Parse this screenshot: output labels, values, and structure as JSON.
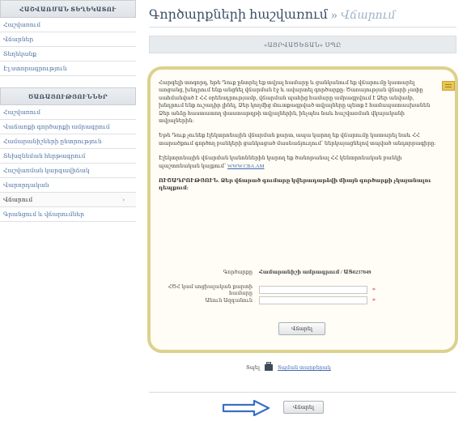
{
  "sidebar": {
    "section1_title": "ՀԱՇՎԱՌՄԱՆ ՏԵՂԵԿԱՏՈՒ",
    "section1_items": [
      "Հաշվառում",
      "Վճարներ",
      "Տեղեկանք",
      "Էլ.ստորագրություն"
    ],
    "section2_title": "ԾԱՌԱՅՈՒԹՅՈՒՆՆԵՐ",
    "section2_items": [
      "Հաշվառում",
      "Վաճառքի գործարքի ամրագրում",
      "Համարանիշների ընտրություն",
      "Տեխզննման հերթագրում",
      "Հաշվառման կարգավիճակ",
      "Վարորդական",
      "Վճարում",
      "Գրանցում և վճարումներ"
    ],
    "active_item": "Վճարում",
    "active_chev": "›"
  },
  "header": {
    "title": "Գործարքների հաշվառում",
    "separator": "»",
    "subtitle": "Վճարում"
  },
  "banner": "«ԱՅՐՎԱԾԵՏԱՆ» ՍՊԸ",
  "panel": {
    "p1": "Հարգելի տոգորդ, եթե Դուք ընտրել եք տվյալ համարը և ցանկանում եք վճարումը կատարել առցանց, խնդրում ենք անցնել վճարման էջ և ավարտել գործարքը: Ծառայության վճարի չափը սահմանված է ՀՀ օրենսդրությամբ, վճարման պահից համարը ամրագրվում է Ձեր անվամբ, խնդրում ենք ուշադիր լինել, Ձեր կողմից մուտքագրված տվյալները պետք է համապատասխանեն Ձեր անձը հաստատող փաստաթղթի տվյալներին, ինչպես նաև հաշվառման վկայականի տվյալներին:",
    "p2": "Եթե Դուք չունեք էլեկտրոնային վճարման քարտ, ապա կարող եք վճարումը կատարել նաև ՀՀ տարածքում գործող բանկերի ցանկացած մասնաճյուղում՝ ներկայացնելով տպված անդորրագիրը:",
    "p3_text": "Էլեկտրոնային վճարման կանոններին կարող եք ծանոթանալ ՀՀ կենտրոնական բանկի պաշտոնական կայքում՝",
    "p3_link": "WWW.CBA.AM",
    "warning": "ՈՒՇԱԴՐՈՒԹՅՈՒՆ. Ձեր վճարած գումարը կվերադարձվի միայն գործարքի չկայանալու դեպքում:",
    "field1_label": "Գործարքը",
    "field1_value": "Համարանիշի ամրագրում / ԱՏ0237049",
    "field2_label": "ՀԾՀ կամ սոցիալական քարտի համարը",
    "field3_label": "Անուն Ազգանուն",
    "required_mark": "*",
    "submit_label": "Վճարել"
  },
  "print": {
    "label": "Տպել",
    "link": "Տպման տարբերակ"
  },
  "bottom_button": "Վճարել"
}
